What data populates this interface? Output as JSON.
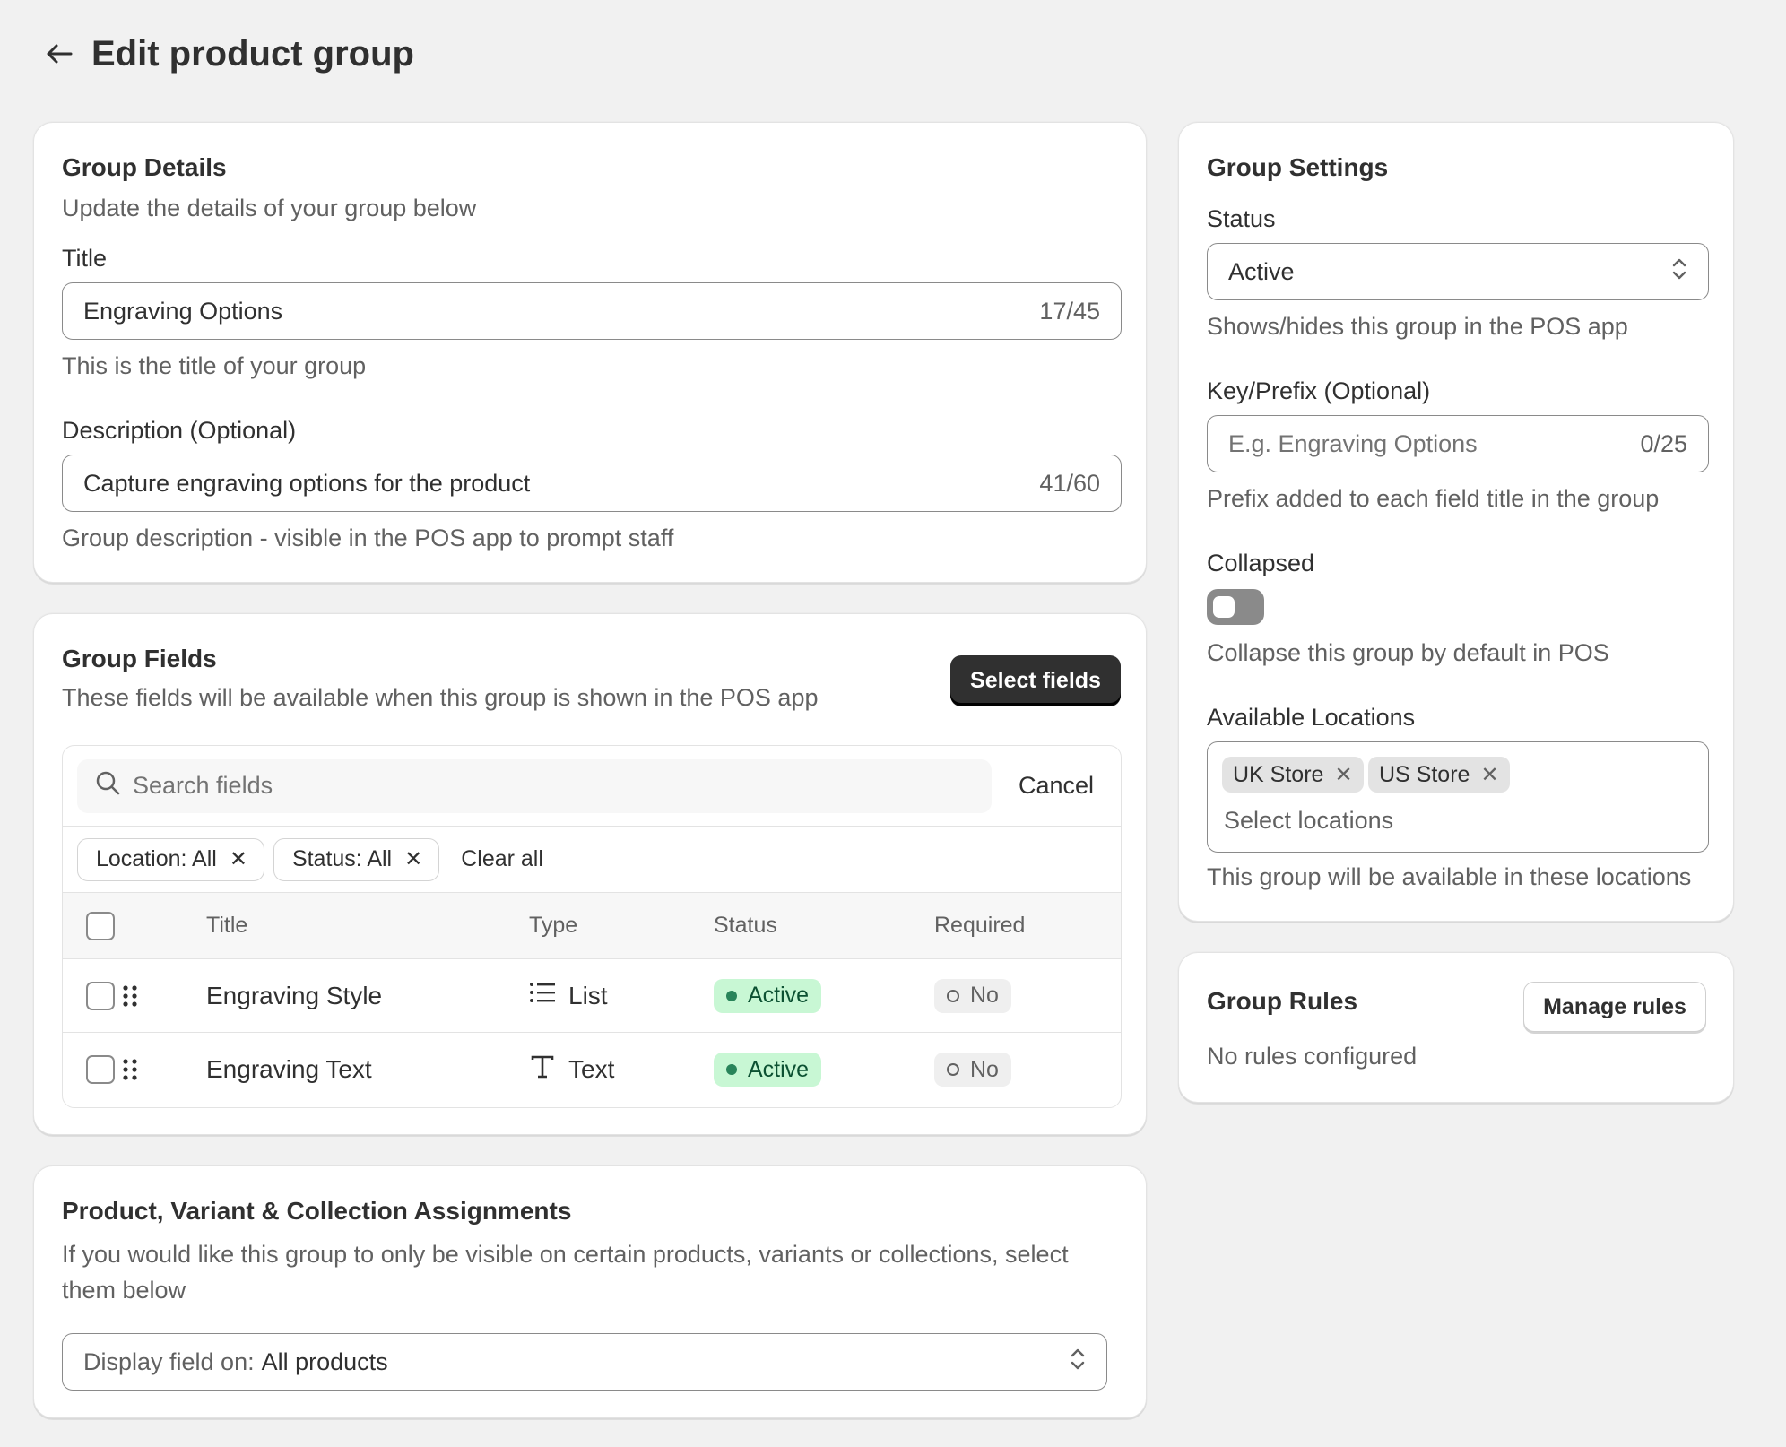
{
  "header": {
    "title": "Edit product group"
  },
  "details": {
    "title": "Group Details",
    "subtitle": "Update the details of your group below",
    "title_label": "Title",
    "title_value": "Engraving Options",
    "title_counter": "17/45",
    "title_help": "This is the title of your group",
    "desc_label": "Description (Optional)",
    "desc_value": "Capture engraving options for the product",
    "desc_counter": "41/60",
    "desc_help": "Group description - visible in the POS app to prompt staff"
  },
  "fields": {
    "title": "Group Fields",
    "subtitle": "These fields will be available when this group is shown in the POS app",
    "select_button": "Select fields",
    "search_placeholder": "Search fields",
    "cancel": "Cancel",
    "filters": [
      "Location: All",
      "Status: All"
    ],
    "clear_all": "Clear all",
    "columns": {
      "title": "Title",
      "type": "Type",
      "status": "Status",
      "required": "Required"
    },
    "rows": [
      {
        "title": "Engraving Style",
        "type": "List",
        "type_icon": "list-icon",
        "status": "Active",
        "required": "No"
      },
      {
        "title": "Engraving Text",
        "type": "Text",
        "type_icon": "text-icon",
        "status": "Active",
        "required": "No"
      }
    ]
  },
  "assignments": {
    "title": "Product, Variant & Collection Assignments",
    "subtitle": "If you would like this group to only be visible on certain products, variants or collections, select them below",
    "select_prefix": "Display field on:",
    "select_value": "All products"
  },
  "settings": {
    "title": "Group Settings",
    "status_label": "Status",
    "status_value": "Active",
    "status_help": "Shows/hides this group in the POS app",
    "key_label": "Key/Prefix (Optional)",
    "key_placeholder": "E.g. Engraving Options",
    "key_counter": "0/25",
    "key_help": "Prefix added to each field title in the group",
    "collapsed_label": "Collapsed",
    "collapsed_on": false,
    "collapsed_help": "Collapse this group by default in POS",
    "locations_label": "Available Locations",
    "locations": [
      "UK Store",
      "US Store"
    ],
    "locations_placeholder": "Select locations",
    "locations_help": "This group will be available in these locations"
  },
  "rules": {
    "title": "Group Rules",
    "manage_button": "Manage rules",
    "empty_text": "No rules configured"
  },
  "colors": {
    "background": "#f1f1f1",
    "primary_button": "#303030",
    "active_badge_bg": "#c8f7d4",
    "active_badge_text": "#0c5132"
  }
}
